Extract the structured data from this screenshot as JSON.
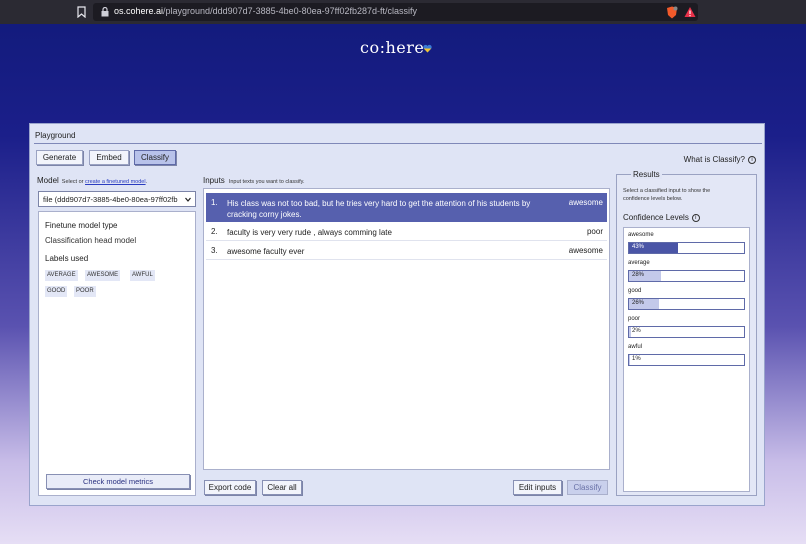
{
  "browser": {
    "url_host": "os.cohere.ai",
    "url_path": "/playground/ddd907d7-3885-4be0-80ea-97ff02fb287d-ft/classify"
  },
  "brand": {
    "logo_text": "co:here"
  },
  "panel": {
    "title": "Playground",
    "tabs": [
      {
        "label": "Generate",
        "active": false
      },
      {
        "label": "Embed",
        "active": false
      },
      {
        "label": "Classify",
        "active": true
      }
    ],
    "what_is": "What is Classify?"
  },
  "model": {
    "label": "Model",
    "hint_prefix": "Select or ",
    "hint_link": "create a finetuned model",
    "hint_suffix": ".",
    "selected": "file (ddd907d7-3885-4be0-80ea-97ff02fb",
    "finetune_title": "Finetune model type",
    "finetune_value": "Classification head model",
    "labels_title": "Labels used",
    "labels": [
      "AVERAGE",
      "AWESOME",
      "AWFUL",
      "GOOD",
      "POOR"
    ],
    "check_metrics": "Check model metrics"
  },
  "inputs": {
    "label": "Inputs",
    "hint": "Input texts you want to classify.",
    "rows": [
      {
        "num": "1.",
        "text": "His class was not too bad, but he tries very hard to get the attention of his students by cracking corny jokes.",
        "label": "awesome",
        "selected": true
      },
      {
        "num": "2.",
        "text": "faculty is very very rude , always comming late",
        "label": "poor",
        "selected": false
      },
      {
        "num": "3.",
        "text": "awesome faculty ever",
        "label": "awesome",
        "selected": false
      }
    ],
    "export_code": "Export code",
    "clear_all": "Clear all",
    "edit_inputs": "Edit inputs",
    "classify": "Classify"
  },
  "results": {
    "title": "Results",
    "hint": "Select a classified input to show the confidence levels below.",
    "confidence_title": "Confidence Levels",
    "levels": [
      {
        "label": "awesome",
        "pct_text": "43%",
        "value": 0.43,
        "color": "#4a55a6"
      },
      {
        "label": "average",
        "pct_text": "28%",
        "value": 0.28,
        "color": "#c3c9ea"
      },
      {
        "label": "good",
        "pct_text": "26%",
        "value": 0.26,
        "color": "#c3c9ea"
      },
      {
        "label": "poor",
        "pct_text": "2%",
        "value": 0.02,
        "color": "#c3c9ea"
      },
      {
        "label": "awful",
        "pct_text": "1%",
        "value": 0.01,
        "color": "#c3c9ea"
      }
    ]
  }
}
